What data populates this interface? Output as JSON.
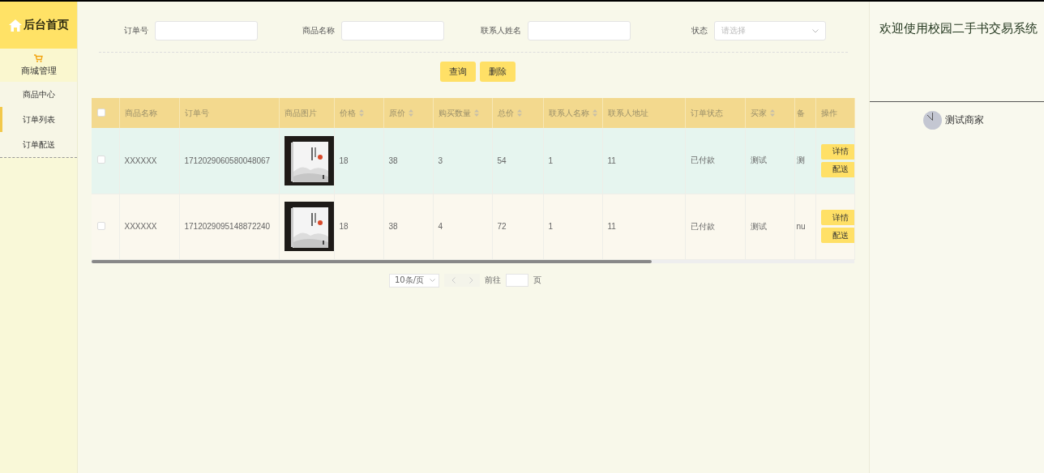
{
  "sidebar": {
    "home": "后台首页",
    "section": "商城管理",
    "items": [
      {
        "label": "商品中心",
        "selected": false
      },
      {
        "label": "订单列表",
        "selected": true
      },
      {
        "label": "订单配送",
        "selected": false
      }
    ]
  },
  "filters": [
    {
      "kind": "input",
      "label": "订单号"
    },
    {
      "kind": "input",
      "label": "商品名称"
    },
    {
      "kind": "input",
      "label": "联系人姓名"
    },
    {
      "kind": "select",
      "label": "状态",
      "placeholder": "请选择"
    }
  ],
  "buttons": [
    "查询",
    "删除"
  ],
  "table": {
    "select_all": {
      "checked": false
    },
    "columns": [
      {
        "label": "商品名称",
        "sortable": false
      },
      {
        "label": "订单号",
        "sortable": false
      },
      {
        "label": "商品图片",
        "sortable": false
      },
      {
        "label": "价格",
        "sortable": true
      },
      {
        "label": "原价",
        "sortable": true
      },
      {
        "label": "购买数量",
        "sortable": true
      },
      {
        "label": "总价",
        "sortable": true
      },
      {
        "label": "联系人名称",
        "sortable": true
      },
      {
        "label": "联系人地址",
        "sortable": false
      },
      {
        "label": "订单状态",
        "sortable": false
      },
      {
        "label": "买家",
        "sortable": true
      },
      {
        "label": "备",
        "sortable": false
      },
      {
        "label": "操作",
        "sortable": false
      }
    ],
    "rows": [
      {
        "hovered": true,
        "checked": false,
        "cells": [
          "XXXXXX",
          "1712029060580048067",
          {
            "kind": "picture"
          },
          "18",
          "38",
          "3",
          "54",
          "1",
          "11",
          "已付款",
          "测试",
          "测"
        ],
        "actions": [
          "详情",
          "配送"
        ]
      },
      {
        "hovered": false,
        "checked": false,
        "cells": [
          "XXXXXX",
          "1712029095148872240",
          {
            "kind": "picture"
          },
          "18",
          "38",
          "4",
          "72",
          "1",
          "11",
          "已付款",
          "测试",
          "nu"
        ],
        "actions": [
          "详情",
          "配送"
        ]
      }
    ]
  },
  "pagination": {
    "page_size": "10条/页",
    "goto_label": "前往",
    "page_unit": "页"
  },
  "welcome": "欢迎使用校园二手书交易系统",
  "user": "测试商家"
}
